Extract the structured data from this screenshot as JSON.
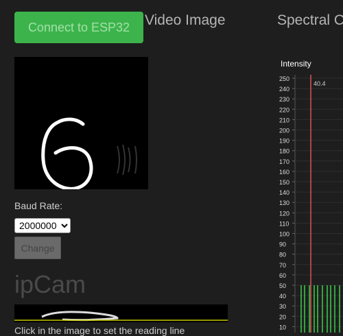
{
  "header": {
    "connect_label": "Connect to ESP32",
    "video_title": "Video Image",
    "spectral_title": "Spectral C"
  },
  "controls": {
    "baud_label": "Baud Rate:",
    "baud_value": "2000000",
    "change_label": "Change"
  },
  "preview": {
    "digit": "6"
  },
  "ipcam": {
    "title": "ipCam",
    "hint": "Click in the image to set the reading line"
  },
  "colors": {
    "connect_bg": "#3cb44b",
    "marker_line": "#e05555",
    "green_bars": "#3bd04a",
    "yellow_line": "#c8c800"
  },
  "chart_data": {
    "type": "bar",
    "ylabel": "Intensity",
    "ylim": [
      0,
      250
    ],
    "yticks": [
      250,
      240,
      230,
      220,
      210,
      200,
      190,
      180,
      170,
      160,
      150,
      140,
      130,
      120,
      110,
      100,
      90,
      80,
      70,
      60,
      50,
      40,
      30,
      20,
      10
    ],
    "marker_label": "40.4",
    "grid": true
  }
}
